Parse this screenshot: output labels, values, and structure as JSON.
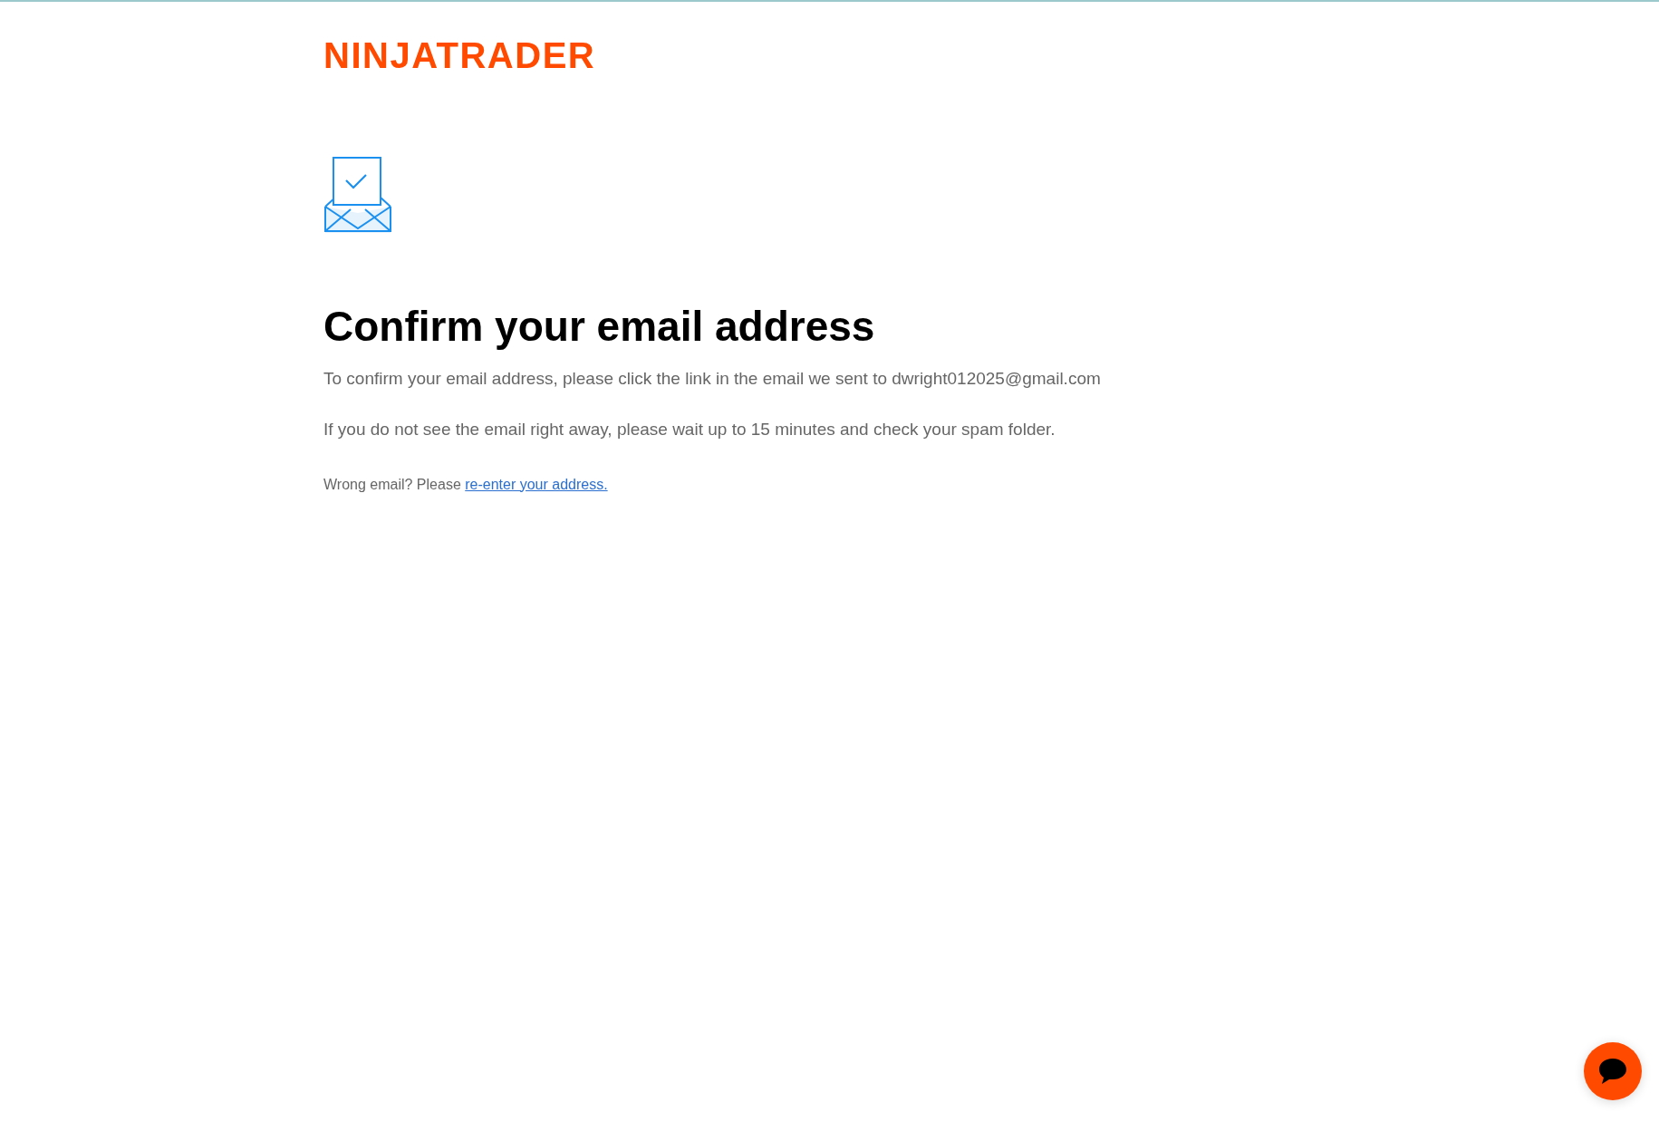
{
  "logo": {
    "text": "NINJATRADER"
  },
  "heading": "Confirm your email address",
  "paragraphs": [
    "To confirm your email address, please click the link in the email we sent to dwright012025@gmail.com",
    "If you do not see the email right away, please wait up to 15 minutes and check your spam folder."
  ],
  "wrong_email": {
    "text": "Wrong email? Please",
    "link": "re-enter your address."
  }
}
